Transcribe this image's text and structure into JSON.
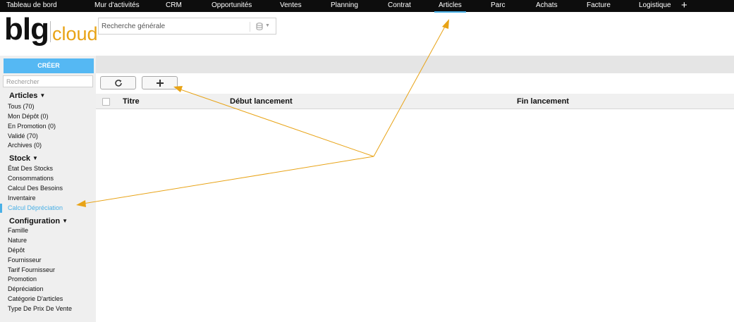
{
  "topnav": {
    "items": [
      {
        "label": "Tableau de bord",
        "active": false
      },
      {
        "label": "Mur d'activités",
        "active": false
      },
      {
        "label": "CRM",
        "active": false
      },
      {
        "label": "Opportunités",
        "active": false
      },
      {
        "label": "Ventes",
        "active": false
      },
      {
        "label": "Planning",
        "active": false
      },
      {
        "label": "Contrat",
        "active": false
      },
      {
        "label": "Articles",
        "active": true
      },
      {
        "label": "Parc",
        "active": false
      },
      {
        "label": "Achats",
        "active": false
      },
      {
        "label": "Facture",
        "active": false
      },
      {
        "label": "Logistique",
        "active": false
      }
    ],
    "add_label": "+"
  },
  "logo": {
    "brand": "blg",
    "product": "cloud",
    "accent_color": "#e8a316"
  },
  "search": {
    "placeholder": "Recherche générale",
    "scope_icon": "database-icon"
  },
  "sidebar": {
    "create_label": "CRÉER",
    "search_placeholder": "Rechercher",
    "sections": [
      {
        "title": "Articles",
        "items": [
          "Tous (70)",
          "Mon Dépôt (0)",
          "En Promotion (0)",
          "Validé (70)",
          "Archives (0)"
        ]
      },
      {
        "title": "Stock",
        "items": [
          "État Des Stocks",
          "Consommations",
          "Calcul Des Besoins",
          "Inventaire",
          "Calcul Dépréciation"
        ]
      },
      {
        "title": "Configuration",
        "items": [
          "Famille",
          "Nature",
          "Dépôt",
          "Fournisseur",
          "Tarif Fournisseur",
          "Promotion",
          "Dépréciation",
          "Catégorie D'articles",
          "Type De Prix De Vente"
        ]
      }
    ],
    "active_item": "Calcul Dépréciation"
  },
  "toolbar": {
    "refresh_icon": "refresh-icon",
    "add_icon": "plus-icon"
  },
  "table": {
    "columns": [
      "Titre",
      "Début lancement",
      "Fin lancement"
    ],
    "rows": []
  },
  "colors": {
    "accent": "#4ab0e6",
    "create_button": "#55b8f3",
    "annotation_arrow": "#e8a316",
    "topnav_bg": "#0d0d0d"
  }
}
